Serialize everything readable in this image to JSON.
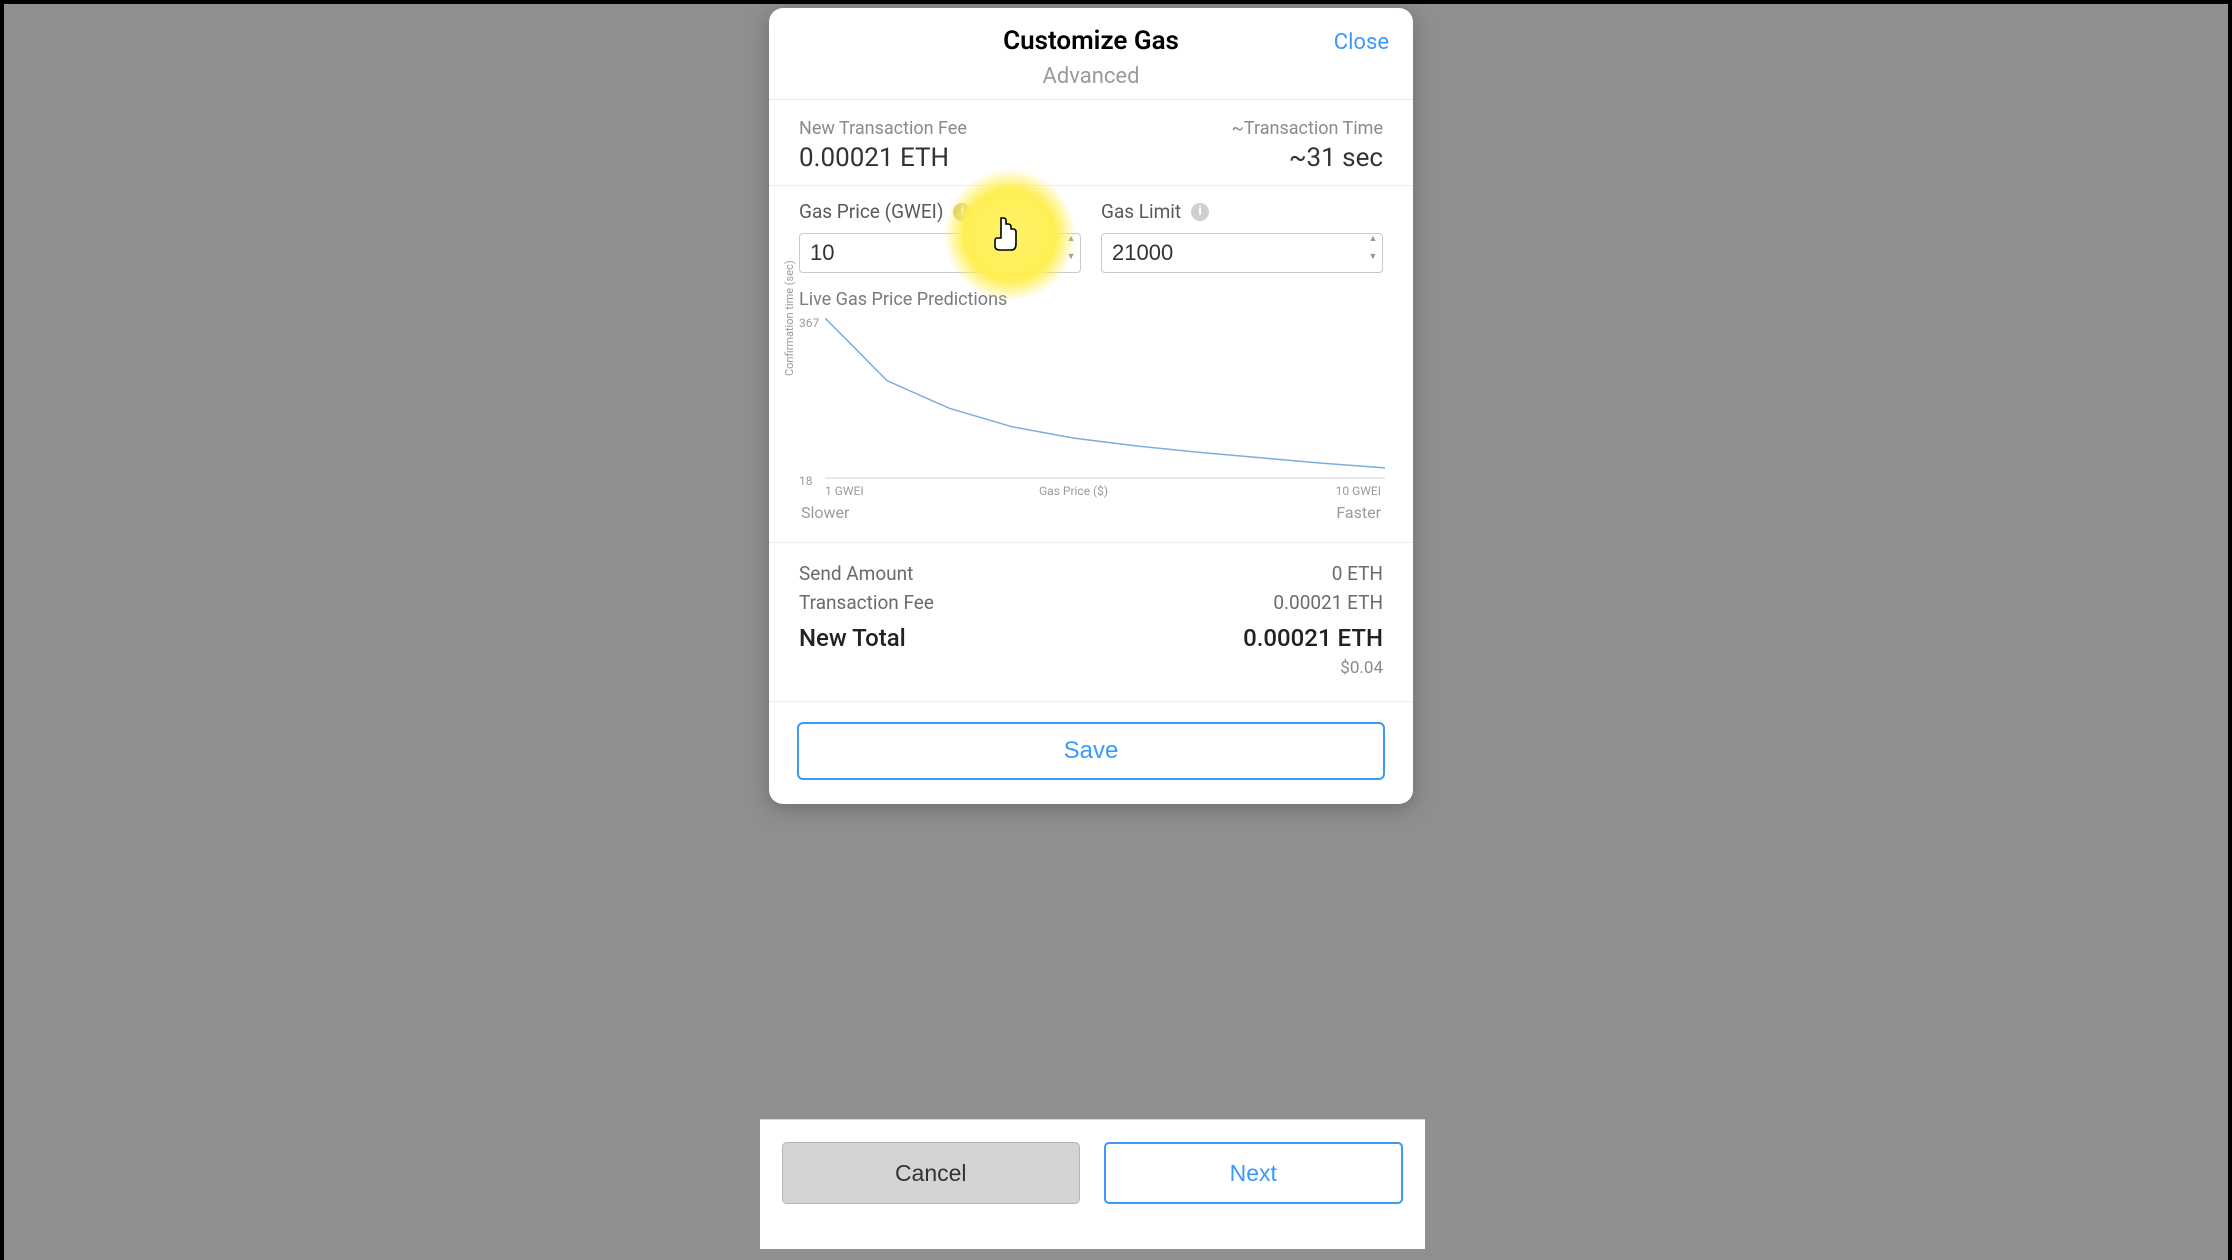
{
  "modal": {
    "title": "Customize Gas",
    "subtitle": "Advanced",
    "close": "Close"
  },
  "fee": {
    "new_label": "New Transaction Fee",
    "new_value": "0.00021 ETH",
    "time_label": "~Transaction Time",
    "time_value": "~31 sec"
  },
  "inputs": {
    "gas_price_label": "Gas Price (GWEI)",
    "gas_price_value": "10",
    "gas_limit_label": "Gas Limit",
    "gas_limit_value": "21000"
  },
  "chart": {
    "title": "Live Gas Price Predictions",
    "y_axis_label": "Confirmation time (sec)",
    "y_max": "367",
    "y_min": "18",
    "x_min_label": "1 GWEI",
    "x_axis_label": "Gas Price ($)",
    "x_max_label": "10 GWEI",
    "slower": "Slower",
    "faster": "Faster"
  },
  "chart_data": {
    "type": "line",
    "xlabel": "Gas Price ($)",
    "ylabel": "Confirmation time (sec)",
    "x_range_label": [
      "1 GWEI",
      "10 GWEI"
    ],
    "ylim": [
      18,
      367
    ],
    "x": [
      1,
      2,
      3,
      4,
      5,
      6,
      7,
      8,
      9,
      10
    ],
    "values": [
      367,
      230,
      170,
      130,
      105,
      88,
      74,
      62,
      50,
      40
    ]
  },
  "summary": {
    "send_label": "Send Amount",
    "send_value": "0 ETH",
    "fee_label": "Transaction Fee",
    "fee_value": "0.00021 ETH",
    "total_label": "New Total",
    "total_value": "0.00021 ETH",
    "usd_value": "$0.04"
  },
  "buttons": {
    "save": "Save",
    "cancel": "Cancel",
    "next": "Next"
  }
}
